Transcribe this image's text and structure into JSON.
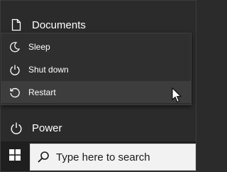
{
  "start_menu": {
    "documents_label": "Documents",
    "power_label": "Power",
    "icons": {
      "documents": "document-icon",
      "power": "power-icon"
    }
  },
  "power_flyout": {
    "items": [
      {
        "label": "Sleep",
        "icon": "moon-icon"
      },
      {
        "label": "Shut down",
        "icon": "power-icon"
      },
      {
        "label": "Restart",
        "icon": "restart-icon",
        "hovered": true
      }
    ]
  },
  "taskbar": {
    "start_icon": "windows-icon",
    "search": {
      "placeholder": "Type here to search",
      "icon": "search-icon"
    }
  },
  "colors": {
    "background": "#2b2b2b",
    "flyout": "#2f2f2f",
    "hover": "#3d3d3d",
    "taskbar": "#1f1f1f",
    "search_box": "#f2f2f2"
  }
}
